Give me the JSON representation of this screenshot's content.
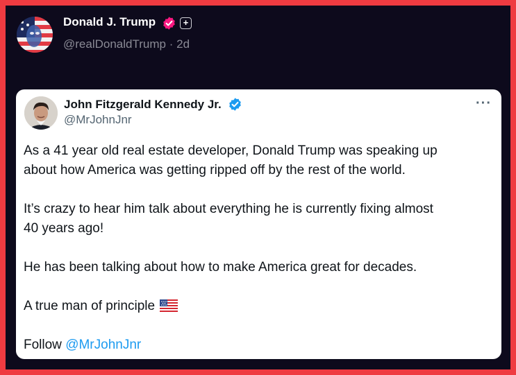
{
  "post": {
    "author_name": "Donald J. Trump",
    "handle": "@realDonaldTrump",
    "separator": "·",
    "time": "2d",
    "plus_icon": "+",
    "colors": {
      "background": "#0d0a1c",
      "border": "#ef3b41",
      "verified": "#f91880"
    },
    "icons": {
      "verified": "verified-badge-icon",
      "plus": "plus-icon"
    }
  },
  "quoted": {
    "author_name": "John Fitzgerald Kennedy Jr.",
    "handle": "@MrJohnJnr",
    "more_icon": "···",
    "colors": {
      "verified": "#1d9bf0",
      "mention": "#1d9bf0"
    },
    "paragraphs": [
      "As a 41 year old real estate developer, Donald Trump was speaking up\nabout how America was getting ripped off by the rest of the world.",
      "It’s crazy to hear him talk about everything he is currently fixing almost\n40 years ago!",
      "He has been talking about how to make America great for decades.",
      "A true man of principle"
    ],
    "flag_icon": "us-flag-icon",
    "follow_text": "Follow",
    "follow_mention": "@MrJohnJnr"
  }
}
